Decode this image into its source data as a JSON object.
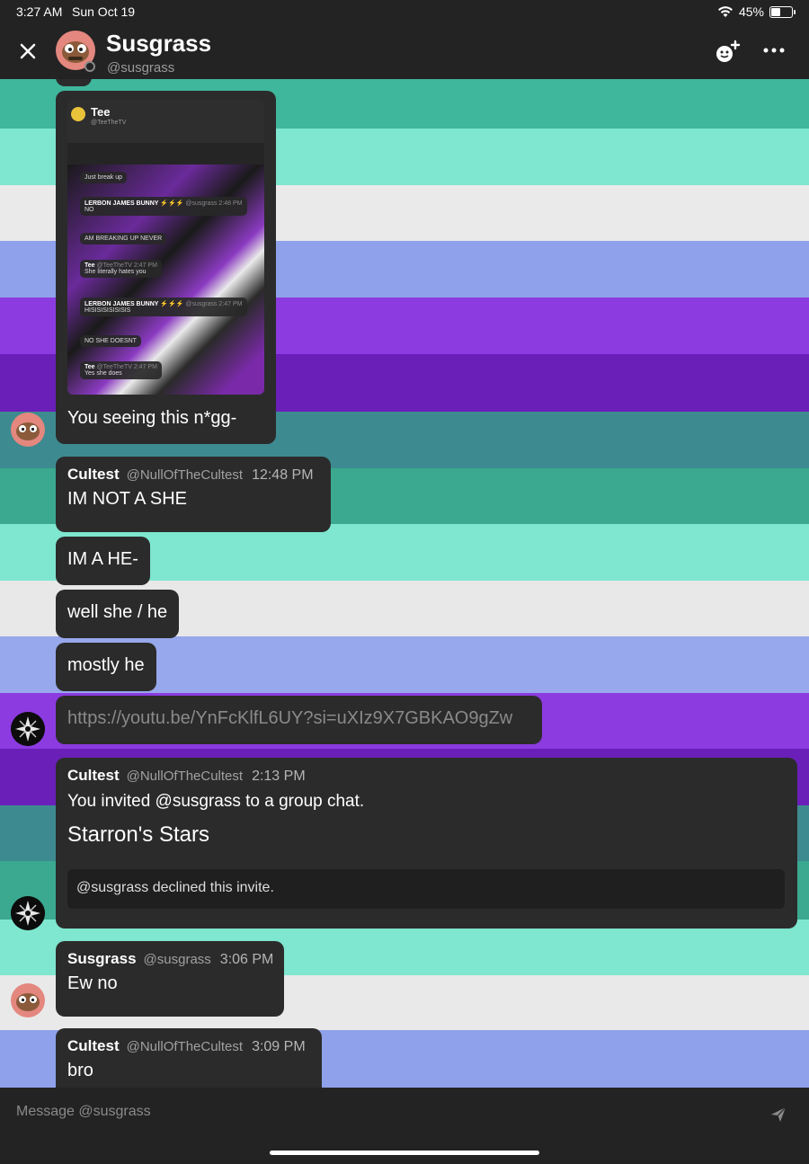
{
  "status_bar": {
    "time": "3:27 AM",
    "date": "Sun Oct 19",
    "battery": "45%",
    "battery_level": 0.45
  },
  "header": {
    "name": "Susgrass",
    "handle": "@susgrass"
  },
  "embedded_screenshot": {
    "name": "Tee",
    "handle": "@TeeTheTV",
    "messages": [
      {
        "text": "Just break up"
      },
      {
        "author": "LERBON JAMES BUNNY ⚡⚡⚡",
        "meta": "@susgrass  2:48 PM",
        "text": "NO"
      },
      {
        "text": "AM BREAKING UP NEVER"
      },
      {
        "author": "Tee",
        "meta": "@TeeTheTV  2:47 PM",
        "text": "She literally hates you"
      },
      {
        "author": "LERBON JAMES BUNNY ⚡⚡⚡",
        "meta": "@susgrass  2:47 PM",
        "text": "HISISISISISISIS"
      },
      {
        "text": "NO SHE DOESNT"
      },
      {
        "author": "Tee",
        "meta": "@TeeTheTV  2:47 PM",
        "text": "Yes she does"
      }
    ],
    "caption": "You seeing this n*gg-"
  },
  "messages": [
    {
      "author": "Cultest",
      "handle": "@NullOfTheCultest",
      "time": "12:48 PM",
      "text": "IM NOT A SHE"
    },
    {
      "text": "IM A HE-"
    },
    {
      "text": "well she / he"
    },
    {
      "text": "mostly he"
    },
    {
      "link": "https://youtu.be/YnFcKlfL6UY?si=uXIz9X7GBKAO9gZw"
    },
    {
      "author": "Cultest",
      "handle": "@NullOfTheCultest",
      "time": "2:13 PM",
      "text": "You invited @susgrass to a group chat.",
      "group_name": "Starron's Stars",
      "invite_status": "@susgrass declined this invite."
    },
    {
      "author": "Susgrass",
      "handle": "@susgrass",
      "time": "3:06 PM",
      "text": "Ew no"
    },
    {
      "author": "Cultest",
      "handle": "@NullOfTheCultest",
      "time": "3:09 PM",
      "text": "bro"
    }
  ],
  "composer": {
    "placeholder": "Message @susgrass"
  },
  "colors": {
    "background": "#1e1e1e",
    "bubble": "#2b2b2b",
    "link": "#8a8a8a"
  },
  "icons": [
    "close-icon",
    "add-friend-icon",
    "more-icon",
    "send-icon",
    "wifi-icon",
    "battery-icon"
  ]
}
